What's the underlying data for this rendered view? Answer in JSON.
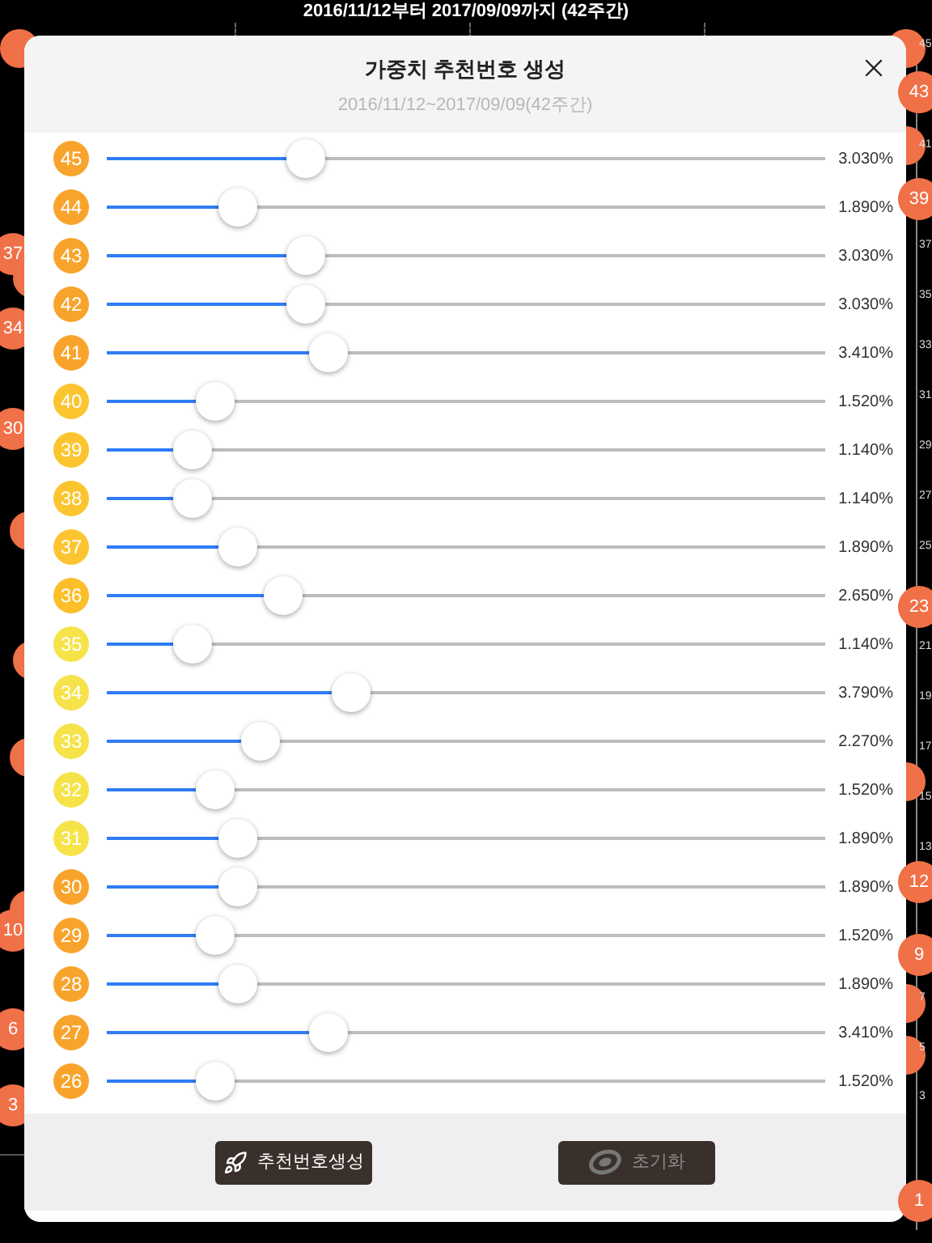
{
  "background": {
    "title": "2016/11/12부터 2017/09/09까지 (42주간)",
    "axis_ticks": [
      "45",
      "41",
      "37",
      "35",
      "33",
      "31",
      "29",
      "27",
      "25",
      "21",
      "19",
      "17",
      "15",
      "13",
      "7",
      "5",
      "3"
    ],
    "bubbles": [
      "37",
      "34",
      "30",
      "10",
      "6",
      "3",
      "43",
      "39",
      "23",
      "12",
      "9",
      "1"
    ]
  },
  "modal": {
    "title": "가중치 추천번호 생성",
    "subtitle": "2016/11/12~2017/09/09(42주간)",
    "weights": [
      {
        "number": "45",
        "color": "#f8a42c",
        "level": 0.277,
        "value": "3.030%"
      },
      {
        "number": "44",
        "color": "#f8a42c",
        "level": 0.182,
        "value": "1.890%"
      },
      {
        "number": "43",
        "color": "#f8a42c",
        "level": 0.277,
        "value": "3.030%"
      },
      {
        "number": "42",
        "color": "#f8a42c",
        "level": 0.277,
        "value": "3.030%"
      },
      {
        "number": "41",
        "color": "#f8a42c",
        "level": 0.309,
        "value": "3.410%"
      },
      {
        "number": "40",
        "color": "#fcc530",
        "level": 0.151,
        "value": "1.520%"
      },
      {
        "number": "39",
        "color": "#fcc530",
        "level": 0.119,
        "value": "1.140%"
      },
      {
        "number": "38",
        "color": "#fcc530",
        "level": 0.119,
        "value": "1.140%"
      },
      {
        "number": "37",
        "color": "#fcc530",
        "level": 0.182,
        "value": "1.890%"
      },
      {
        "number": "36",
        "color": "#fbbf2a",
        "level": 0.245,
        "value": "2.650%"
      },
      {
        "number": "35",
        "color": "#f6e34a",
        "level": 0.119,
        "value": "1.140%"
      },
      {
        "number": "34",
        "color": "#f6e34a",
        "level": 0.34,
        "value": "3.790%"
      },
      {
        "number": "33",
        "color": "#f6e34a",
        "level": 0.214,
        "value": "2.270%"
      },
      {
        "number": "32",
        "color": "#f6e34a",
        "level": 0.151,
        "value": "1.520%"
      },
      {
        "number": "31",
        "color": "#f6e34a",
        "level": 0.182,
        "value": "1.890%"
      },
      {
        "number": "30",
        "color": "#f8a42c",
        "level": 0.182,
        "value": "1.890%"
      },
      {
        "number": "29",
        "color": "#f8a42c",
        "level": 0.151,
        "value": "1.520%"
      },
      {
        "number": "28",
        "color": "#f8a42c",
        "level": 0.182,
        "value": "1.890%"
      },
      {
        "number": "27",
        "color": "#f8a42c",
        "level": 0.309,
        "value": "3.410%"
      },
      {
        "number": "26",
        "color": "#f8a42c",
        "level": 0.151,
        "value": "1.520%"
      }
    ],
    "buttons": [
      {
        "label": "추천번호생성",
        "kind": "generate",
        "disabled": false
      },
      {
        "label": "초기화",
        "kind": "reset",
        "disabled": true
      }
    ]
  }
}
